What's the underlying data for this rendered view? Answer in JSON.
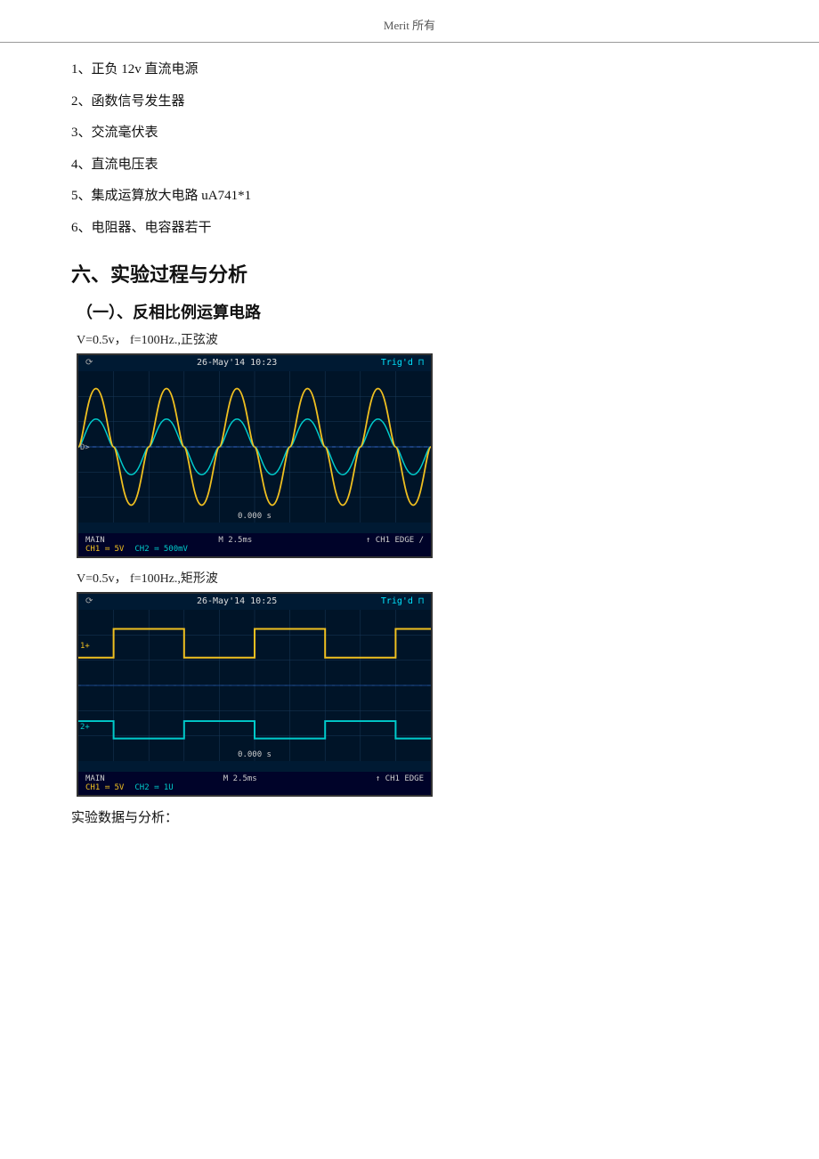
{
  "header": {
    "text": "Merit 所有"
  },
  "equipment_list": {
    "items": [
      {
        "id": "1",
        "text": "1、正负 12v 直流电源"
      },
      {
        "id": "2",
        "text": "2、函数信号发生器"
      },
      {
        "id": "3",
        "text": "3、交流毫伏表"
      },
      {
        "id": "4",
        "text": "4、直流电压表"
      },
      {
        "id": "5",
        "text": "5、集成运算放大电路 uA741*1"
      },
      {
        "id": "6",
        "text": "6、电阻器、电容器若干"
      }
    ]
  },
  "section6": {
    "title": "六、实验过程与分析",
    "subsection1": {
      "title": "（一）、反相比例运算电路",
      "osc1": {
        "params": "V=0.5v，   f=100Hz.,正弦波",
        "header_left": "⟳",
        "header_center": "26-May'14 10:23",
        "header_right": "Trig'd ⊓",
        "time_marker": "0.000 s",
        "footer_main": "M 2.5ms",
        "footer_edge": "↑ CH1 EDGE  /",
        "ch1": "CH1 ≕ 5V",
        "ch2": "CH2 ≕ 500mV",
        "footer_main_label": "MAIN"
      },
      "osc2": {
        "params": "V=0.5v，   f=100Hz.,矩形波",
        "header_left": "⟳",
        "header_center": "26-May'14 10:25",
        "header_right": "Trig'd ⊓",
        "time_marker": "0.000 s",
        "footer_main": "M 2.5ms",
        "footer_edge": "↑ CH1 EDGE",
        "ch1": "CH1 ≕ 5V",
        "ch2": "CH2 ≕ 1U",
        "footer_main_label": "MAIN"
      },
      "analysis_label": "实验数据与分析："
    }
  }
}
